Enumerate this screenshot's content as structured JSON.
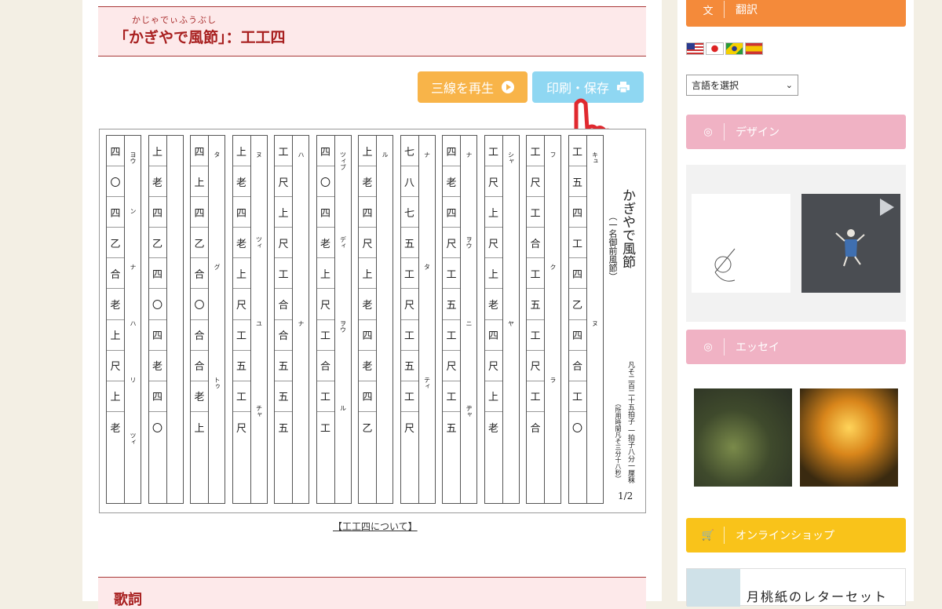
{
  "page": {
    "ruby": "かじゃでぃふうぶし",
    "title": "「かぎやで風節」：工工四",
    "play_button": "三線を再生",
    "print_button": "印刷・保存",
    "about_link": "【工工四について】",
    "lyrics_heading": "歌詞"
  },
  "score": {
    "title": "かぎやで風節",
    "subtitle": "（一名御前風節）",
    "meta": "凡そ二百二十五拍子 一拍子八分一厘秣",
    "meta2": "（所用時間凡そ三分十八秒）",
    "page": "1/2",
    "columns": [
      {
        "cells": [
          "四",
          "〇",
          "四",
          "乙",
          "合",
          "老",
          "上",
          "尺",
          "上",
          "老"
        ],
        "kana": [
          "ヨウ",
          "ン",
          "ナ",
          "ハ",
          "リ",
          "ツィ"
        ]
      },
      {
        "cells": [
          "上",
          "老",
          "四",
          "乙",
          "四",
          "〇",
          "四",
          "老",
          "四",
          "〇"
        ],
        "kana": []
      },
      {
        "cells": [
          "四",
          "上",
          "四",
          "乙",
          "合",
          "〇",
          "合",
          "合",
          "老",
          "上"
        ],
        "kana": [
          "タ",
          "グ",
          "トゥ"
        ]
      },
      {
        "cells": [
          "上",
          "老",
          "四",
          "老",
          "上",
          "尺",
          "工",
          "五",
          "工",
          "尺"
        ],
        "kana": [
          "ヌ",
          "ツィ",
          "ユ",
          "チャ"
        ]
      },
      {
        "cells": [
          "工",
          "尺",
          "上",
          "尺",
          "工",
          "合",
          "合",
          "五",
          "五",
          "五"
        ],
        "kana": [
          "ハ",
          "ナ"
        ]
      },
      {
        "cells": [
          "四",
          "〇",
          "四",
          "老",
          "上",
          "尺",
          "工",
          "合",
          "工",
          "工"
        ],
        "kana": [
          "ツィブ",
          "ディ",
          "ヲウ",
          "ル"
        ]
      },
      {
        "cells": [
          "上",
          "老",
          "四",
          "尺",
          "上",
          "老",
          "四",
          "老",
          "四",
          "乙"
        ],
        "kana": [
          "ル"
        ]
      },
      {
        "cells": [
          "七",
          "八",
          "七",
          "五",
          "工",
          "尺",
          "工",
          "五",
          "工",
          "尺"
        ],
        "kana": [
          "ナ",
          "タ",
          "ティ"
        ]
      },
      {
        "cells": [
          "四",
          "老",
          "四",
          "尺",
          "工",
          "五",
          "工",
          "尺",
          "工",
          "五"
        ],
        "kana": [
          "ナ",
          "ヲウ",
          "ニ",
          "ヂャ"
        ]
      },
      {
        "cells": [
          "工",
          "尺",
          "上",
          "尺",
          "上",
          "老",
          "四",
          "尺",
          "上",
          "老"
        ],
        "kana": [
          "シャ",
          "ヤ"
        ]
      },
      {
        "cells": [
          "工",
          "尺",
          "工",
          "合",
          "工",
          "五",
          "工",
          "尺",
          "工",
          "合"
        ],
        "kana": [
          "フ",
          "ク",
          "ラ"
        ]
      },
      {
        "cells": [
          "工",
          "五",
          "四",
          "工",
          "四",
          "乙",
          "四",
          "合",
          "工",
          "〇"
        ],
        "kana": [
          "キュ",
          "ヌ"
        ]
      }
    ]
  },
  "sidebar": {
    "translate_label": "翻訳",
    "language_select": "言語を選択",
    "design_label": "デザイン",
    "essay_label": "エッセイ",
    "shop_label": "オンラインショップ",
    "shop_item": "月桃紙のレターセット",
    "colors": {
      "translate": "#f48a3a",
      "design": "#f0b2c4",
      "essay": "#f0b2c4",
      "shop": "#f9c31a"
    }
  }
}
